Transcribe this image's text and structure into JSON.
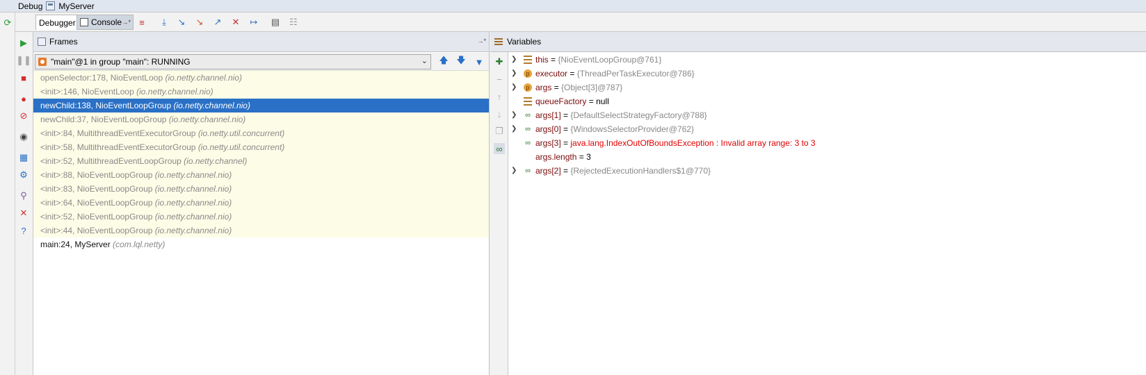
{
  "titlebar": {
    "debug_label": "Debug",
    "config_name": "MyServer"
  },
  "tabs": {
    "debugger": "Debugger",
    "console": "Console"
  },
  "frames_panel": {
    "title": "Frames",
    "thread": "\"main\"@1 in group \"main\": RUNNING",
    "frames": [
      {
        "method": "openSelector:178, NioEventLoop",
        "pkg": "(io.netty.channel.nio)"
      },
      {
        "method": "<init>:146, NioEventLoop",
        "pkg": "(io.netty.channel.nio)"
      },
      {
        "method": "newChild:138, NioEventLoopGroup",
        "pkg": "(io.netty.channel.nio)"
      },
      {
        "method": "newChild:37, NioEventLoopGroup",
        "pkg": "(io.netty.channel.nio)"
      },
      {
        "method": "<init>:84, MultithreadEventExecutorGroup",
        "pkg": "(io.netty.util.concurrent)"
      },
      {
        "method": "<init>:58, MultithreadEventExecutorGroup",
        "pkg": "(io.netty.util.concurrent)"
      },
      {
        "method": "<init>:52, MultithreadEventLoopGroup",
        "pkg": "(io.netty.channel)"
      },
      {
        "method": "<init>:88, NioEventLoopGroup",
        "pkg": "(io.netty.channel.nio)"
      },
      {
        "method": "<init>:83, NioEventLoopGroup",
        "pkg": "(io.netty.channel.nio)"
      },
      {
        "method": "<init>:64, NioEventLoopGroup",
        "pkg": "(io.netty.channel.nio)"
      },
      {
        "method": "<init>:52, NioEventLoopGroup",
        "pkg": "(io.netty.channel.nio)"
      },
      {
        "method": "<init>:44, NioEventLoopGroup",
        "pkg": "(io.netty.channel.nio)"
      },
      {
        "method": "main:24, MyServer",
        "pkg": "(com.lql.netty)"
      }
    ]
  },
  "variables_panel": {
    "title": "Variables",
    "vars": [
      {
        "name": "this",
        "eq": " = ",
        "value": "{NioEventLoopGroup@761}"
      },
      {
        "name": "executor",
        "eq": " = ",
        "value": "{ThreadPerTaskExecutor@786}"
      },
      {
        "name": "args",
        "eq": " = ",
        "value": "{Object[3]@787}"
      },
      {
        "name": "queueFactory",
        "eq": " = ",
        "value": "null"
      },
      {
        "name": "args[1]",
        "eq": " = ",
        "value": "{DefaultSelectStrategyFactory@788}"
      },
      {
        "name": "args[0]",
        "eq": " = ",
        "value": "{WindowsSelectorProvider@762}"
      },
      {
        "name": "args[3]",
        "eq": " = ",
        "value": "java.lang.IndexOutOfBoundsException : Invalid array range: 3 to 3"
      },
      {
        "name": "args.length",
        "eq": " = ",
        "value": "3"
      },
      {
        "name": "args[2]",
        "eq": " = ",
        "value": "{RejectedExecutionHandlers$1@770}"
      }
    ]
  },
  "icons": {
    "param_letter": "p",
    "selected_frame_color": "#2a70c6",
    "frame_bg_color": "#fdfde7",
    "error_color": "#e00000"
  }
}
